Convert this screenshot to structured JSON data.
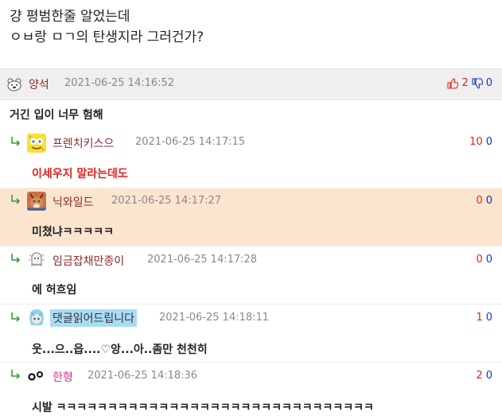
{
  "post": {
    "line1": "걍 평범한줄 알었는데",
    "line2": "ㅇㅂ랑 ㅁㄱ의 탄생지라 그러건가?"
  },
  "parent": {
    "author": "양석",
    "date": "2021-06-25 14:16:52",
    "up": "2",
    "down": "0",
    "text": "거긴 입이 너무 험해"
  },
  "replies": [
    {
      "author": "프렌치키스으",
      "date": "2021-06-25 14:17:15",
      "up": "10",
      "down": "0",
      "text": "이세우지 말라는데도",
      "text_color": "#e02020",
      "avatar": "sponge-avatar"
    },
    {
      "author": "닉와일드",
      "date": "2021-06-25 14:17:27",
      "up": "0",
      "down": "0",
      "text": "미쳤냐ㅋㅋㅋㅋㅋ",
      "avatar": "fox-avatar"
    },
    {
      "author": "임금잡채만종이",
      "date": "2021-06-25 14:17:28",
      "up": "0",
      "down": "0",
      "text": "에 허흐임",
      "avatar": "ghost-avatar"
    },
    {
      "author": "댓글읽어드립니다",
      "date": "2021-06-25 14:18:11",
      "up": "1",
      "down": "0",
      "text": "웃...으..읍....♡앙...아..좀만 천천히",
      "avatar": "anime-avatar"
    },
    {
      "author": "한형",
      "date": "2021-06-25 14:18:36",
      "up": "2",
      "down": "0",
      "text": "시발 ㅋㅋㅋㅋㅋㅋㅋㅋㅋㅋㅋㅋㅋㅋㅋㅋㅋㅋㅋㅋㅋㅋㅋㅋㅋㅋㅋㅋㅋㅋㅋ",
      "avatar": "dots-avatar"
    }
  ],
  "colors": {
    "up": "#e02020",
    "down": "#2030c0",
    "highlight_bg": "#fbe5cf",
    "parent_bg": "#efefef",
    "name_highlight": "#a8dcf5",
    "author_pink": "#d0308a",
    "author_brown": "#8b2a2a"
  }
}
